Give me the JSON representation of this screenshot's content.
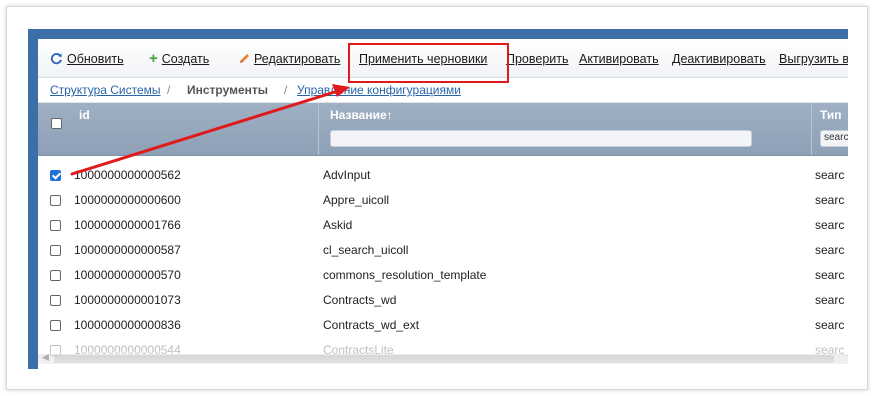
{
  "toolbar": {
    "refresh_label": "Обновить",
    "create_label": "Создать",
    "edit_label": "Редактировать",
    "apply_drafts_label": "Применить черновики",
    "check_label": "Проверить",
    "activate_label": "Активировать",
    "deactivate_label": "Деактивировать",
    "export_label": "Выгрузить в"
  },
  "breadcrumb": {
    "items": [
      "Структура Системы",
      "Инструменты",
      "Управление конфигурациями"
    ],
    "separator": "/"
  },
  "table": {
    "columns": [
      "id",
      "Название↑",
      "Тип"
    ],
    "type_filter_value": "searc",
    "rows": [
      {
        "id": "1000000000000562",
        "name": "AdvInput",
        "type": "searc",
        "checked": true
      },
      {
        "id": "1000000000000600",
        "name": "Appre_uicoll",
        "type": "searc",
        "checked": false
      },
      {
        "id": "1000000000001766",
        "name": "Askid",
        "type": "searc",
        "checked": false
      },
      {
        "id": "1000000000000587",
        "name": "cl_search_uicoll",
        "type": "searc",
        "checked": false
      },
      {
        "id": "1000000000000570",
        "name": "commons_resolution_template",
        "type": "searc",
        "checked": false
      },
      {
        "id": "1000000000001073",
        "name": "Contracts_wd",
        "type": "searc",
        "checked": false
      },
      {
        "id": "1000000000000836",
        "name": "Contracts_wd_ext",
        "type": "searc",
        "checked": false
      },
      {
        "id": "1000000000000544",
        "name": "ContractsLite",
        "type": "searc",
        "checked": false
      }
    ]
  },
  "icons": {
    "refresh": "refresh-icon",
    "create": "plus-icon",
    "edit": "pencil-icon"
  },
  "colors": {
    "frame_blue": "#3c6fa8",
    "header_bg": "#9aabc0",
    "link": "#2a63a8",
    "checkbox_on": "#1e6fd9",
    "annotation": "#e0191b"
  }
}
